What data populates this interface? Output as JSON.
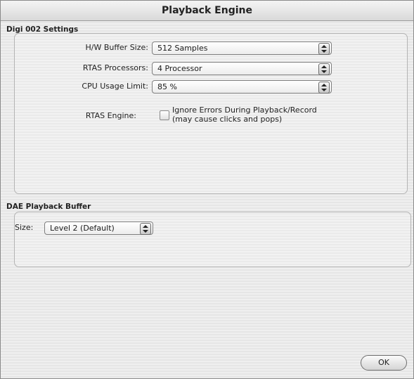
{
  "window": {
    "title": "Playback Engine"
  },
  "digi_settings": {
    "title": "Digi 002 Settings",
    "hw_buffer": {
      "label": "H/W Buffer Size:",
      "value": "512 Samples"
    },
    "rtas_processors": {
      "label": "RTAS Processors:",
      "value": "4 Processor"
    },
    "cpu_usage": {
      "label": "CPU Usage Limit:",
      "value": "85 %"
    },
    "rtas_engine": {
      "label": "RTAS Engine:",
      "checkbox_line1": "Ignore Errors During Playback/Record",
      "checkbox_line2": "(may cause clicks and pops)",
      "checked": false
    }
  },
  "dae_buffer": {
    "title": "DAE Playback Buffer",
    "size": {
      "label": "Size:",
      "value": "Level 2 (Default)"
    }
  },
  "buttons": {
    "ok": "OK"
  },
  "icons": {
    "popup": "updown-arrows-icon"
  }
}
